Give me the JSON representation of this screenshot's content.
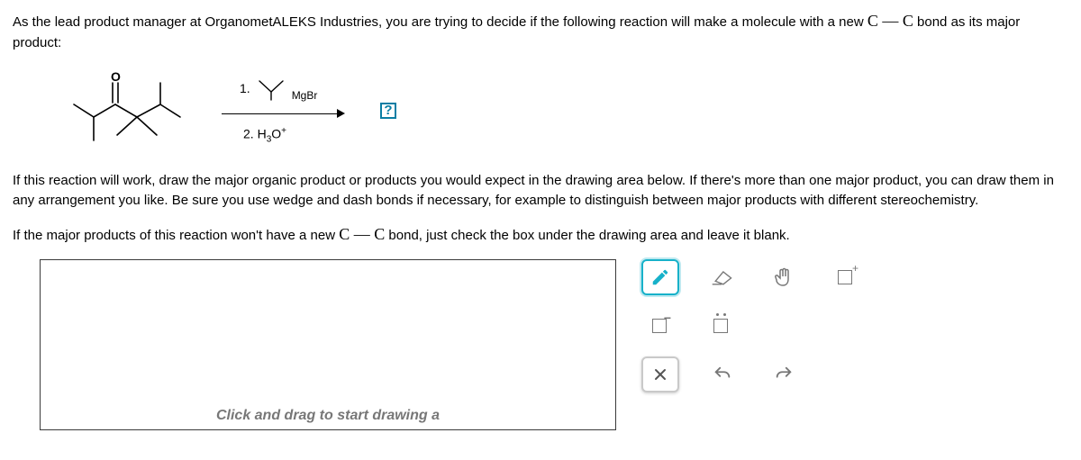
{
  "prompt": {
    "intro_part1": "As the lead product manager at OrganometALEKS Industries, you are trying to decide if the following reaction will make a molecule with a new ",
    "intro_cc": "C — C",
    "intro_part2": " bond as its major product:",
    "mid": "If this reaction will work, draw the major organic product or products you would expect in the drawing area below. If there's more than one major product, you can draw them in any arrangement you like. Be sure you use wedge and dash bonds if necessary, for example to distinguish between major products with different stereochemistry.",
    "bot_part1": "If the major products of this reaction won't have a new ",
    "bot_cc": "C — C",
    "bot_part2": " bond, just check the box under the drawing area and leave it blank."
  },
  "reaction": {
    "step1_label": "1.",
    "step1_reagent": "MgBr",
    "step2_label": "2. H",
    "step2_sub": "3",
    "step2_after": "O",
    "step2_sup": "+",
    "product_placeholder": "?"
  },
  "canvas": {
    "hint": "Click and drag to start drawing a"
  },
  "tools": {
    "row1": [
      "pencil",
      "eraser",
      "hand",
      "charge-plus"
    ],
    "row2": [
      "charge-minus",
      "lone-pair"
    ],
    "row3": [
      "clear",
      "undo",
      "redo"
    ]
  }
}
